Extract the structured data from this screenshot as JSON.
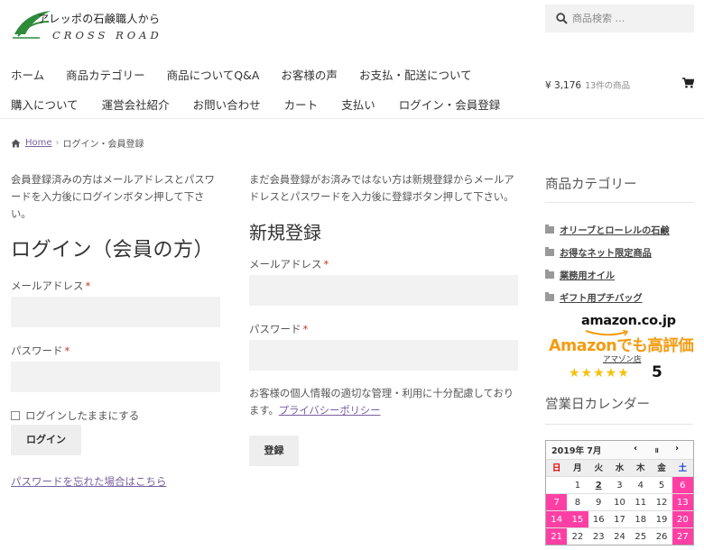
{
  "header": {
    "logo_line1": "アレッポの石鹸職人から",
    "logo_line2": "CROSS ROAD",
    "search_placeholder": "商品検索 …",
    "nav_row1": [
      "ホーム",
      "商品カテゴリー",
      "商品についてQ&A",
      "お客様の声",
      "お支払・配送について"
    ],
    "nav_row2": [
      "購入について",
      "運営会社紹介",
      "お問い合わせ",
      "カート",
      "支払い",
      "ログイン・会員登録"
    ],
    "cart_total": "¥ 3,176",
    "cart_count": "13件の商品"
  },
  "breadcrumb": {
    "home": "Home",
    "separator": "›",
    "current": "ログイン・会員登録"
  },
  "login": {
    "intro": "会員登録済みの方はメールアドレスとパスワードを入力後にログインボタン押して下さい。",
    "heading": "ログイン（会員の方）",
    "email_label": "メールアドレス",
    "password_label": "パスワード",
    "required_mark": "*",
    "remember_label": "ログインしたままにする",
    "button": "ログイン",
    "lost_password": "パスワードを忘れた場合はこちら"
  },
  "register": {
    "intro": "まだ会員登録がお済みではない方は新規登録からメールアドレスとパスワードを入力後に登録ボタン押して下さい。",
    "heading": "新規登録",
    "email_label": "メールアドレス",
    "password_label": "パスワード",
    "required_mark": "*",
    "privacy_text": "お客様の個人情報の適切な管理・利用に十分配慮しております。",
    "privacy_link": "プライバシーポリシー",
    "button": "登録"
  },
  "sidebar": {
    "categories_title": "商品カテゴリー",
    "categories": [
      "オリーブとローレルの石鹸",
      "お得なネット限定商品",
      "業務用オイル",
      "ギフト用プチバッグ"
    ],
    "amazon": {
      "logo": "amazon.co.jp",
      "headline": "Amazonでも高評価",
      "store": "アマゾン店",
      "stars": "★★★★★",
      "rating": "5"
    },
    "calendar_title": "営業日カレンダー",
    "calendar": {
      "month": "2019年 7月",
      "prev": "‹",
      "pause": "॥",
      "next": "›",
      "weekdays": [
        "日",
        "月",
        "火",
        "水",
        "木",
        "金",
        "土"
      ],
      "rows": [
        [
          "",
          "1",
          "2",
          "3",
          "4",
          "5",
          "6"
        ],
        [
          "7",
          "8",
          "9",
          "10",
          "11",
          "12",
          "13"
        ],
        [
          "14",
          "15",
          "16",
          "17",
          "18",
          "19",
          "20"
        ],
        [
          "21",
          "22",
          "23",
          "24",
          "25",
          "26",
          "27"
        ]
      ],
      "holidays": [
        "6",
        "7",
        "13",
        "14",
        "15",
        "20",
        "21",
        "27"
      ],
      "today": "2"
    }
  },
  "colors": {
    "link": "#7a5fa0",
    "holiday": "#ff3fa4",
    "amazon_orange": "#f39c12",
    "logo_green": "#2e8b3a"
  }
}
